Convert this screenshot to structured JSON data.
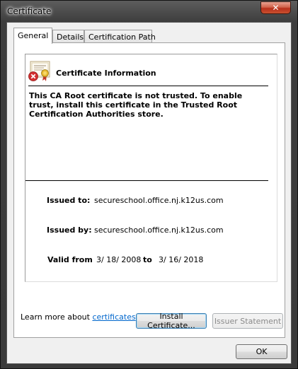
{
  "window": {
    "title": "Certificate",
    "close_glyph": "✕"
  },
  "tabs": [
    {
      "label": "General",
      "active": true
    },
    {
      "label": "Details",
      "active": false
    },
    {
      "label": "Certification Path",
      "active": false
    }
  ],
  "general": {
    "icon": "certificate-error-icon",
    "heading": "Certificate Information",
    "warning": "This CA Root certificate is not trusted. To enable trust, install this certificate in the Trusted Root Certification Authorities store.",
    "issued_to_label": "Issued to:",
    "issued_to": "secureschool.office.nj.k12us.com",
    "issued_by_label": "Issued by:",
    "issued_by": "secureschool.office.nj.k12us.com",
    "valid_from_label": "Valid from",
    "valid_from": "3/ 18/ 2008",
    "valid_to_label": "to",
    "valid_to": "3/ 16/ 2018"
  },
  "buttons": {
    "install": "Install Certificate...",
    "issuer_statement": "Issuer Statement",
    "ok": "OK"
  },
  "learn_more": {
    "prefix": "Learn more about ",
    "link": "certificates"
  },
  "colors": {
    "link": "#0066cc",
    "close_button": "#c9502f",
    "error_badge": "#d32f2f"
  }
}
